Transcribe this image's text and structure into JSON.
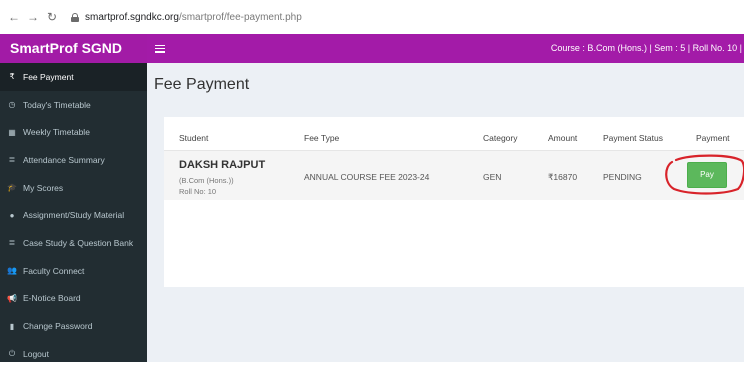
{
  "browser": {
    "url_domain": "smartprof.sgndkc.org",
    "url_path": "/smartprof/fee-payment.php"
  },
  "header": {
    "brand": "SmartProf SGND",
    "course_info": "Course : B.Com (Hons.) | Sem : 5 | Roll No. 10 |",
    "accent_color": "#a31ba8"
  },
  "sidebar": {
    "items": [
      {
        "icon": "rupee-icon",
        "glyph": "₹",
        "label": "Fee Payment",
        "active": true
      },
      {
        "icon": "clock-icon",
        "glyph": "◷",
        "label": "Today's Timetable"
      },
      {
        "icon": "calendar-icon",
        "glyph": "▦",
        "label": "Weekly Timetable"
      },
      {
        "icon": "list-icon",
        "glyph": "≣",
        "label": "Attendance Summary"
      },
      {
        "icon": "graduation-cap-icon",
        "glyph": "🎓",
        "label": "My Scores"
      },
      {
        "icon": "comments-icon",
        "glyph": "●",
        "label": "Assignment/Study Material"
      },
      {
        "icon": "list-icon",
        "glyph": "≣",
        "label": "Case Study & Question Bank"
      },
      {
        "icon": "users-icon",
        "glyph": "👥",
        "label": "Faculty Connect"
      },
      {
        "icon": "bullhorn-icon",
        "glyph": "📢",
        "label": "E-Notice Board"
      },
      {
        "icon": "bookmark-icon",
        "glyph": "▮",
        "label": "Change Password"
      },
      {
        "icon": "power-icon",
        "glyph": "⏻",
        "label": "Logout"
      }
    ]
  },
  "main": {
    "title": "Fee Payment",
    "table": {
      "headers": [
        "Student",
        "Fee Type",
        "Category",
        "Amount",
        "Payment Status",
        "Payment"
      ],
      "rows": [
        {
          "student_name": "DAKSH RAJPUT",
          "student_course": "(B.Com (Hons.))",
          "student_roll": "Roll No: 10",
          "fee_type": "ANNUAL COURSE FEE 2023-24",
          "category": "GEN",
          "amount": "₹16870",
          "status": "PENDING",
          "pay_label": "Pay"
        }
      ]
    },
    "pay_color": "#5cb85c"
  }
}
